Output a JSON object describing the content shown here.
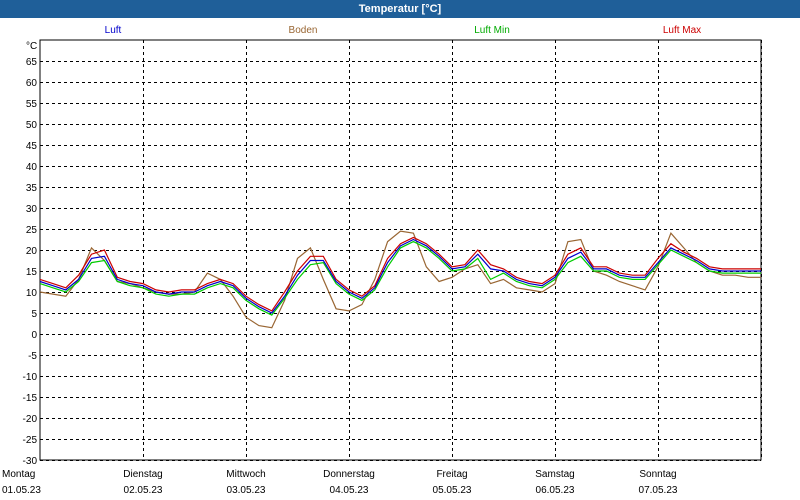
{
  "window": {
    "title": "Temperatur [°C]"
  },
  "chart_data": {
    "type": "line",
    "title": "Temperatur [°C]",
    "ylabel": "°C",
    "ylim": [
      -30,
      70
    ],
    "yticks": [
      65,
      60,
      55,
      50,
      45,
      40,
      35,
      30,
      25,
      20,
      15,
      10,
      5,
      0,
      -5,
      -10,
      -15,
      -20,
      -25,
      -30
    ],
    "grid": true,
    "legend_position": "top",
    "x_days": [
      {
        "day": "Montag",
        "date": "01.05.23"
      },
      {
        "day": "Dienstag",
        "date": "02.05.23"
      },
      {
        "day": "Mittwoch",
        "date": "03.05.23"
      },
      {
        "day": "Donnerstag",
        "date": "04.05.23"
      },
      {
        "day": "Freitag",
        "date": "05.05.23"
      },
      {
        "day": "Samstag",
        "date": "06.05.23"
      },
      {
        "day": "Sonntag",
        "date": "07.05.23"
      }
    ],
    "x_hours": [
      0,
      3,
      6,
      9,
      12,
      15,
      18,
      21,
      24,
      27,
      30,
      33,
      36,
      39,
      42,
      45,
      48,
      51,
      54,
      57,
      60,
      63,
      66,
      69,
      72,
      75,
      78,
      81,
      84,
      87,
      90,
      93,
      96,
      99,
      102,
      105,
      108,
      111,
      114,
      117,
      120,
      123,
      126,
      129,
      132,
      135,
      138,
      141,
      144,
      147,
      150,
      153,
      156,
      159,
      162,
      165,
      168
    ],
    "series": [
      {
        "name": "Luft",
        "color": "#0000cc",
        "values": [
          12.5,
          11.5,
          10.5,
          13,
          18,
          18.5,
          13,
          12,
          11.5,
          10,
          9.5,
          10,
          10,
          11.5,
          12.5,
          11.5,
          8.5,
          6.5,
          5,
          9,
          14,
          17.5,
          17.5,
          12.5,
          10,
          8.5,
          11,
          17,
          21,
          22.5,
          21,
          18.5,
          15.5,
          16,
          19,
          15.5,
          15,
          13,
          12,
          11.5,
          13.5,
          18,
          19.5,
          15.5,
          15.5,
          14,
          13.5,
          13.5,
          17,
          20.5,
          19,
          17.5,
          15.5,
          15,
          15,
          15,
          15
        ]
      },
      {
        "name": "Boden",
        "color": "#996633",
        "values": [
          10,
          9.5,
          9,
          13,
          20.5,
          17.5,
          12.5,
          12,
          11,
          10,
          9.5,
          9.5,
          10,
          14.5,
          13,
          9,
          4,
          2,
          1.5,
          8,
          18,
          20.5,
          13,
          6,
          5.5,
          7,
          13,
          22,
          24.5,
          24,
          16,
          12.5,
          13.5,
          15.5,
          16.5,
          12,
          13,
          11,
          10.5,
          10,
          12,
          22,
          22.5,
          15,
          14,
          12.5,
          11.5,
          10.5,
          16,
          24,
          20.5,
          17,
          15,
          14,
          14,
          13.5,
          13.5
        ]
      },
      {
        "name": "Luft Min",
        "color": "#00cc00",
        "values": [
          12,
          11,
          10,
          12.5,
          17,
          17.5,
          12.5,
          11.5,
          11,
          9.5,
          9,
          9.5,
          9.5,
          11,
          12,
          11,
          8,
          6,
          4.5,
          8.5,
          13,
          16.5,
          17,
          12,
          9.5,
          8,
          10.5,
          16,
          20.5,
          22,
          20.5,
          18,
          15,
          15.5,
          18,
          13,
          14.5,
          12.5,
          11.5,
          11,
          13,
          17,
          18.5,
          15,
          15,
          13.5,
          13,
          13,
          16.5,
          20,
          18.5,
          17,
          15,
          14.5,
          14.5,
          14.5,
          14.5
        ]
      },
      {
        "name": "Luft Max",
        "color": "#cc0000",
        "values": [
          13,
          12,
          11,
          14,
          19,
          20,
          13.5,
          12.5,
          12,
          10.5,
          10,
          10.5,
          10.5,
          12,
          13,
          12,
          9,
          7,
          5.5,
          10,
          15,
          18.5,
          18.5,
          13,
          10.5,
          9,
          11.5,
          18,
          21.5,
          23,
          21.5,
          19,
          16,
          16.5,
          20,
          16.5,
          15.5,
          13.5,
          12.5,
          12,
          14,
          19,
          20.5,
          16,
          16,
          14.5,
          14,
          14,
          18,
          21.5,
          19.5,
          18,
          16,
          15.5,
          15.5,
          15.5,
          15.5
        ]
      }
    ]
  }
}
